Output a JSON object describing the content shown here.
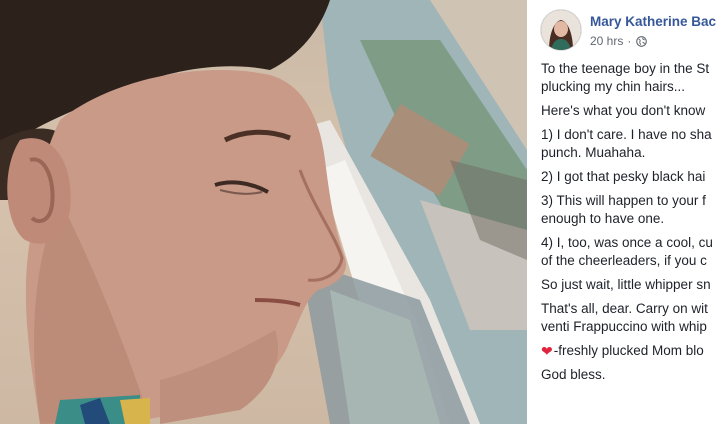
{
  "post": {
    "author_name": "Mary Katherine Bac",
    "timestamp": "20 hrs",
    "separator": "·",
    "privacy_icon": "globe-icon",
    "paragraphs": [
      {
        "lines": [
          "To the teenage boy in the St",
          "plucking my chin hairs..."
        ]
      },
      {
        "lines": [
          "Here's what you don't know"
        ]
      },
      {
        "lines": [
          "1) I don't care. I have no sha",
          "punch. Muahaha."
        ]
      },
      {
        "lines": [
          "2) I got that pesky black hai"
        ]
      },
      {
        "lines": [
          "3) This will happen to your f",
          "enough to have one."
        ]
      },
      {
        "lines": [
          "4) I, too, was once a cool, cu",
          "of the cheerleaders, if you c"
        ]
      },
      {
        "lines": [
          "So just wait, little whipper sn"
        ]
      },
      {
        "lines": [
          "That's all, dear. Carry on wit",
          "venti Frappuccino with whip"
        ]
      }
    ],
    "signoff_heart": "❤",
    "signoff_text": "-freshly plucked Mom blo",
    "closing": "God bless."
  },
  "colors": {
    "author_link": "#365899",
    "meta_text": "#616770",
    "body_text": "#1d2129",
    "heart": "#e0243e"
  }
}
